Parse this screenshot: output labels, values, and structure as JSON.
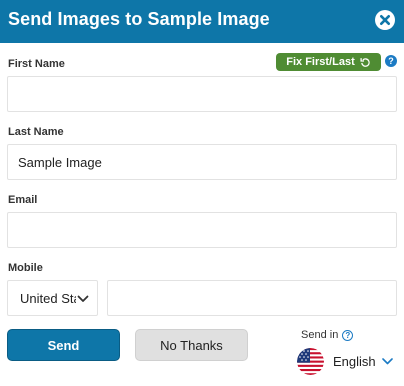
{
  "header": {
    "title": "Send Images to Sample Image",
    "close_icon": "close-circle-icon"
  },
  "form": {
    "first_name": {
      "label": "First Name",
      "value": "",
      "placeholder": ""
    },
    "fix_button": {
      "label": "Fix First/Last",
      "icon": "undo-icon",
      "color": "#4f8c33"
    },
    "help_icon": "question-circle-icon",
    "last_name": {
      "label": "Last Name",
      "value": "Sample Image",
      "placeholder": ""
    },
    "email": {
      "label": "Email",
      "value": "",
      "placeholder": ""
    },
    "mobile": {
      "label": "Mobile",
      "country_selected": "United States",
      "value": "",
      "placeholder": ""
    }
  },
  "actions": {
    "send_label": "Send",
    "no_thanks_label": "No Thanks"
  },
  "send_in": {
    "label": "Send in",
    "help_icon": "question-circle-icon",
    "language": "English",
    "flag_icon": "us-flag-icon"
  },
  "colors": {
    "primary": "#0e76a8",
    "accent_green": "#4f8c33",
    "secondary_button": "#e0e0e0"
  }
}
